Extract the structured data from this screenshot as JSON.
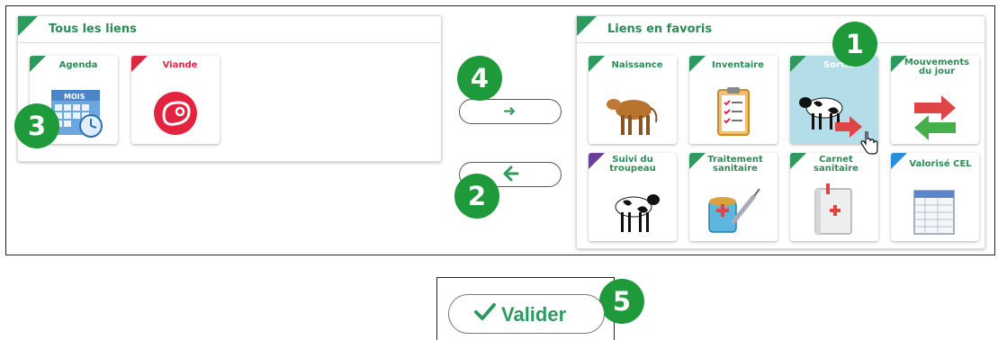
{
  "all_links_panel": {
    "title": "Tous les liens",
    "tiles": [
      {
        "label": "Agenda",
        "icon": "calendar-icon",
        "corner_color": "#2e9a5d"
      },
      {
        "label": "Viande",
        "icon": "meat-icon",
        "corner_color": "#d9283f"
      }
    ]
  },
  "favorites_panel": {
    "title": "Liens en favoris",
    "tiles": [
      {
        "label": "Naissance",
        "icon": "calf-icon",
        "corner_color": "#2e9a5d"
      },
      {
        "label": "Inventaire",
        "icon": "clipboard-icon",
        "corner_color": "#2e9a5d"
      },
      {
        "label": "Sortie",
        "icon": "cow-exit-icon",
        "corner_color": "#2e9a5d",
        "selected": true
      },
      {
        "label": "Mouvements du jour",
        "icon": "exchange-arrows-icon",
        "corner_color": "#2e9a5d"
      },
      {
        "label": "Suivi du troupeau",
        "icon": "herd-icon",
        "corner_color": "#6a3f97"
      },
      {
        "label": "Traitement sanitaire",
        "icon": "syringe-icon",
        "corner_color": "#2e9a5d"
      },
      {
        "label": "Carnet sanitaire",
        "icon": "health-book-icon",
        "corner_color": "#2e9a5d"
      },
      {
        "label": "Valorisé CEL",
        "icon": "spreadsheet-icon",
        "corner_color": "#2b8ed8"
      }
    ]
  },
  "buttons": {
    "move_right_arrow": "➜",
    "move_left_arrow": "🡐",
    "valider_label": "Valider"
  },
  "badges": [
    "1",
    "2",
    "3",
    "4",
    "5"
  ],
  "colors": {
    "accent_green": "#2e9a5d",
    "badge_green": "#1f9a3b",
    "selected_bg": "#b3dde8",
    "red": "#d9283f"
  }
}
